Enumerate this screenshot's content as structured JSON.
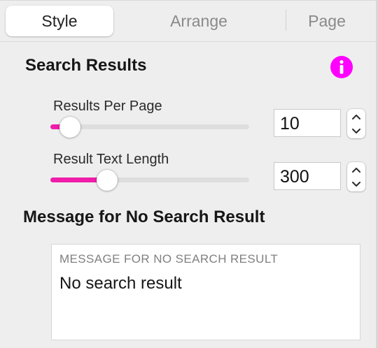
{
  "tabs": [
    {
      "label": "Style",
      "active": true
    },
    {
      "label": "Arrange",
      "active": false
    },
    {
      "label": "Page",
      "active": false
    }
  ],
  "search_results": {
    "title": "Search Results",
    "info_icon": "info-icon",
    "results_per_page": {
      "label": "Results Per Page",
      "value": "10",
      "slider_fraction": 0.1
    },
    "result_text_length": {
      "label": "Result Text Length",
      "value": "300",
      "slider_fraction": 0.285
    }
  },
  "no_result_message": {
    "title": "Message for No Search Result",
    "field_label": "MESSAGE FOR NO SEARCH RESULT",
    "value": "No search result"
  },
  "colors": {
    "accent": "#f01caa",
    "info_icon": "#ff00ff"
  }
}
